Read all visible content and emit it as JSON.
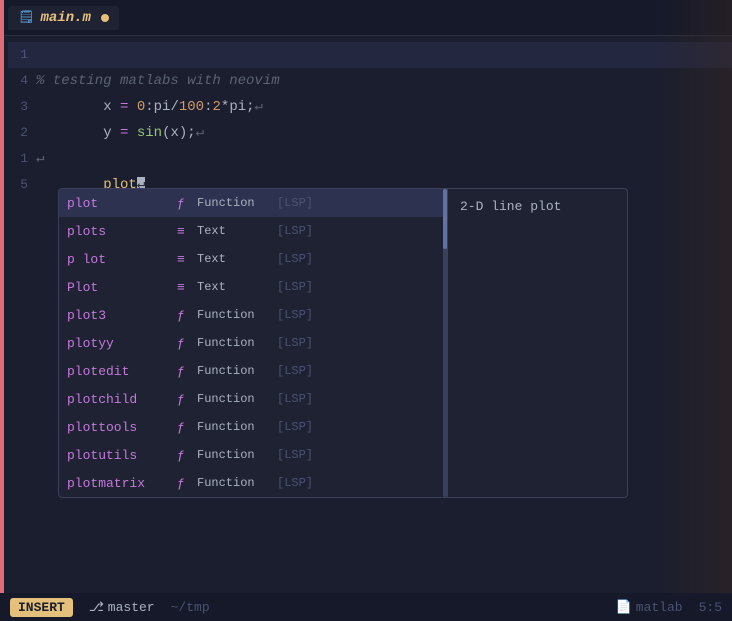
{
  "tab": {
    "icon": "📄",
    "name": "main.m",
    "modified": true
  },
  "lines": [
    {
      "number": "1",
      "content": "",
      "highlight": true,
      "cursor": true
    },
    {
      "number": "4",
      "comment": "% testing matlabs with neovim"
    },
    {
      "number": "3",
      "code": "x = 0:pi/100:2*pi;↵"
    },
    {
      "number": "2",
      "code": "y = sin(x);↵"
    },
    {
      "number": "1",
      "code": "↵"
    },
    {
      "number": "5",
      "code": "plot↵",
      "active": true
    }
  ],
  "autocomplete": {
    "items": [
      {
        "name": "plot",
        "icon": "ƒ",
        "type": "Function",
        "source": "[LSP]",
        "selected": true
      },
      {
        "name": "plots",
        "icon": "≡",
        "type": "Text",
        "source": "[LSP]"
      },
      {
        "name": "p lot",
        "icon": "≡",
        "type": "Text",
        "source": "[LSP]"
      },
      {
        "name": "Plot",
        "icon": "≡",
        "type": "Text",
        "source": "[LSP]"
      },
      {
        "name": "plot3",
        "icon": "ƒ",
        "type": "Function",
        "source": "[LSP]"
      },
      {
        "name": "plotyy",
        "icon": "ƒ",
        "type": "Function",
        "source": "[LSP]"
      },
      {
        "name": "plotedit",
        "icon": "ƒ",
        "type": "Function",
        "source": "[LSP]"
      },
      {
        "name": "plotchild",
        "icon": "ƒ",
        "type": "Function",
        "source": "[LSP]"
      },
      {
        "name": "plottools",
        "icon": "ƒ",
        "type": "Function",
        "source": "[LSP]"
      },
      {
        "name": "plotutils",
        "icon": "ƒ",
        "type": "Function",
        "source": "[LSP]"
      },
      {
        "name": "plotmatrix",
        "icon": "ƒ",
        "type": "Function",
        "source": "[LSP]"
      }
    ],
    "doc": "2-D line plot"
  },
  "statusbar": {
    "mode": "INSERT",
    "git_icon": "⎇",
    "branch": "master",
    "path": "~/tmp",
    "file_icon": "📄",
    "filetype": "matlab",
    "position": "5:5"
  }
}
